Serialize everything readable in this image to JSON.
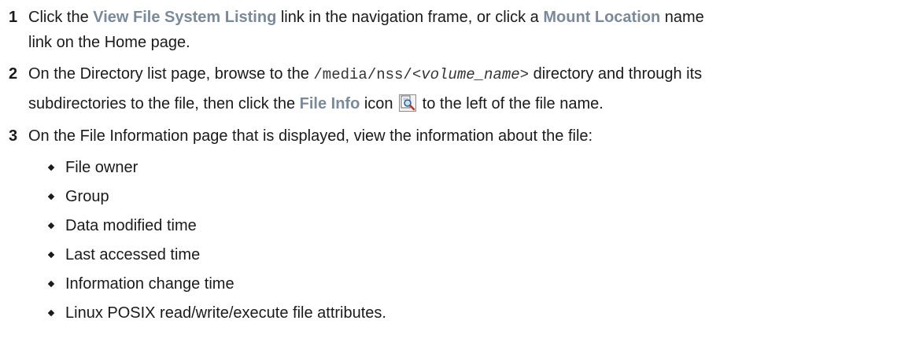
{
  "steps": [
    {
      "number": "1",
      "text_1": "Click the ",
      "link_1": "View File System Listing",
      "text_2": " link in the navigation frame, or click a ",
      "link_2": "Mount Location",
      "text_3": " name",
      "text_4": "link on the Home page."
    },
    {
      "number": "2",
      "text_1": "On the Directory list page, browse to the ",
      "path_prefix": "/media/nss/",
      "path_var": "<volume_name>",
      "text_2": " directory and through its",
      "text_3": "subdirectories to the file, then click the ",
      "link_1": "File Info",
      "text_4": " icon ",
      "icon": "file-info-magnifier-icon",
      "text_5": " to the left of the file name."
    },
    {
      "number": "3",
      "text_1": "On the File Information page that is displayed, view the information about the file:",
      "bullets": [
        "File owner",
        "Group",
        "Data modified time",
        "Last accessed time",
        "Information change time",
        "Linux POSIX read/write/execute file attributes."
      ]
    }
  ],
  "colors": {
    "ui_link": "#7a8a99",
    "text": "#1a1a1a"
  }
}
